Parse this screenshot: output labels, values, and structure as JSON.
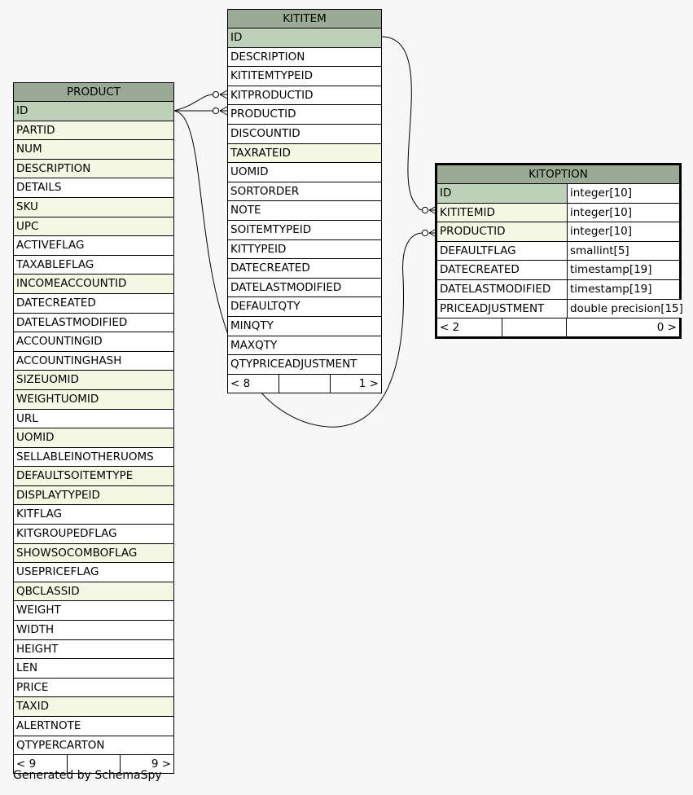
{
  "tables": {
    "product": {
      "name": "PRODUCT",
      "columns": [
        {
          "name": "ID",
          "kind": "pk"
        },
        {
          "name": "PARTID",
          "kind": "fk"
        },
        {
          "name": "NUM",
          "kind": "fk"
        },
        {
          "name": "DESCRIPTION",
          "kind": "fk"
        },
        {
          "name": "DETAILS",
          "kind": "plain"
        },
        {
          "name": "SKU",
          "kind": "fk"
        },
        {
          "name": "UPC",
          "kind": "fk"
        },
        {
          "name": "ACTIVEFLAG",
          "kind": "plain"
        },
        {
          "name": "TAXABLEFLAG",
          "kind": "plain"
        },
        {
          "name": "INCOMEACCOUNTID",
          "kind": "fk"
        },
        {
          "name": "DATECREATED",
          "kind": "plain"
        },
        {
          "name": "DATELASTMODIFIED",
          "kind": "plain"
        },
        {
          "name": "ACCOUNTINGID",
          "kind": "plain"
        },
        {
          "name": "ACCOUNTINGHASH",
          "kind": "plain"
        },
        {
          "name": "SIZEUOMID",
          "kind": "fk"
        },
        {
          "name": "WEIGHTUOMID",
          "kind": "fk"
        },
        {
          "name": "URL",
          "kind": "plain"
        },
        {
          "name": "UOMID",
          "kind": "fk"
        },
        {
          "name": "SELLABLEINOTHERUOMS",
          "kind": "plain"
        },
        {
          "name": "DEFAULTSOITEMTYPE",
          "kind": "fk"
        },
        {
          "name": "DISPLAYTYPEID",
          "kind": "fk"
        },
        {
          "name": "KITFLAG",
          "kind": "plain"
        },
        {
          "name": "KITGROUPEDFLAG",
          "kind": "plain"
        },
        {
          "name": "SHOWSOCOMBOFLAG",
          "kind": "fk"
        },
        {
          "name": "USEPRICEFLAG",
          "kind": "plain"
        },
        {
          "name": "QBCLASSID",
          "kind": "fk"
        },
        {
          "name": "WEIGHT",
          "kind": "plain"
        },
        {
          "name": "WIDTH",
          "kind": "plain"
        },
        {
          "name": "HEIGHT",
          "kind": "plain"
        },
        {
          "name": "LEN",
          "kind": "plain"
        },
        {
          "name": "PRICE",
          "kind": "plain"
        },
        {
          "name": "TAXID",
          "kind": "fk"
        },
        {
          "name": "ALERTNOTE",
          "kind": "plain"
        },
        {
          "name": "QTYPERCARTON",
          "kind": "plain"
        }
      ],
      "footer": [
        "< 9",
        "",
        "9 >"
      ]
    },
    "kititem": {
      "name": "KITITEM",
      "columns": [
        {
          "name": "ID",
          "kind": "pk"
        },
        {
          "name": "DESCRIPTION",
          "kind": "plain"
        },
        {
          "name": "KITITEMTYPEID",
          "kind": "plain"
        },
        {
          "name": "KITPRODUCTID",
          "kind": "plain"
        },
        {
          "name": "PRODUCTID",
          "kind": "plain"
        },
        {
          "name": "DISCOUNTID",
          "kind": "plain"
        },
        {
          "name": "TAXRATEID",
          "kind": "fk"
        },
        {
          "name": "UOMID",
          "kind": "plain"
        },
        {
          "name": "SORTORDER",
          "kind": "plain"
        },
        {
          "name": "NOTE",
          "kind": "plain"
        },
        {
          "name": "SOITEMTYPEID",
          "kind": "plain"
        },
        {
          "name": "KITTYPEID",
          "kind": "plain"
        },
        {
          "name": "DATECREATED",
          "kind": "plain"
        },
        {
          "name": "DATELASTMODIFIED",
          "kind": "plain"
        },
        {
          "name": "DEFAULTQTY",
          "kind": "plain"
        },
        {
          "name": "MINQTY",
          "kind": "plain"
        },
        {
          "name": "MAXQTY",
          "kind": "plain"
        },
        {
          "name": "QTYPRICEADJUSTMENT",
          "kind": "plain"
        }
      ],
      "footer": [
        "< 8",
        "",
        "1 >"
      ]
    },
    "kitoption": {
      "name": "KITOPTION",
      "columns": [
        {
          "name": "ID",
          "type": "integer[10]",
          "kind": "pk"
        },
        {
          "name": "KITITEMID",
          "type": "integer[10]",
          "kind": "fk"
        },
        {
          "name": "PRODUCTID",
          "type": "integer[10]",
          "kind": "fk"
        },
        {
          "name": "DEFAULTFLAG",
          "type": "smallint[5]",
          "kind": "plain"
        },
        {
          "name": "DATECREATED",
          "type": "timestamp[19]",
          "kind": "plain"
        },
        {
          "name": "DATELASTMODIFIED",
          "type": "timestamp[19]",
          "kind": "plain"
        },
        {
          "name": "PRICEADJUSTMENT",
          "type": "double precision[15]",
          "kind": "plain"
        }
      ],
      "footer": [
        "< 2",
        "",
        "0 >"
      ]
    }
  },
  "footer_note": "Generated by SchemaSpy"
}
